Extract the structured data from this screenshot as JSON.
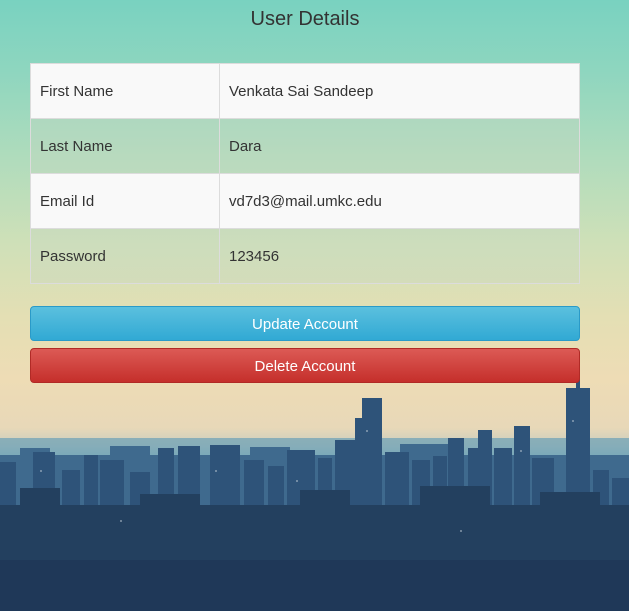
{
  "page": {
    "title": "User Details"
  },
  "user_details": [
    {
      "label": "First Name",
      "value": "Venkata Sai Sandeep"
    },
    {
      "label": "Last Name",
      "value": "Dara"
    },
    {
      "label": "Email Id",
      "value": "vd7d3@mail.umkc.edu"
    },
    {
      "label": "Password",
      "value": "123456"
    }
  ],
  "actions": {
    "update_label": "Update Account",
    "delete_label": "Delete Account"
  },
  "colors": {
    "update_button": "#31a9d4",
    "delete_button": "#c52f2b",
    "sky_top": "#79d2c0",
    "city": "#27466c"
  },
  "background": {
    "scene": "city-skyline-background"
  }
}
